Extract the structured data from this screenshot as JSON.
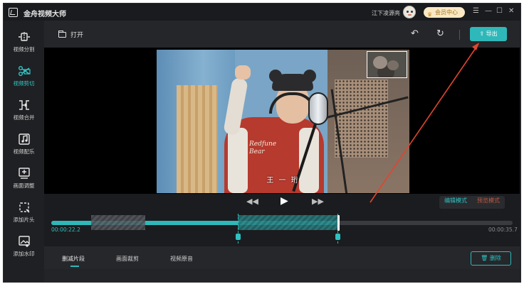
{
  "app": {
    "title": "金舟视频大师",
    "username": "江下凌源亮",
    "vip_label": "会员中心",
    "window_controls": [
      "☰",
      "—",
      "☐",
      "✕"
    ]
  },
  "sidebar": {
    "items": [
      {
        "label": "视频分割",
        "icon": "split-icon",
        "active": false
      },
      {
        "label": "视频剪切",
        "icon": "scissors-icon",
        "active": true
      },
      {
        "label": "视频合并",
        "icon": "merge-icon",
        "active": false
      },
      {
        "label": "视频配乐",
        "icon": "music-icon",
        "active": false
      },
      {
        "label": "画面调整",
        "icon": "adjust-icon",
        "active": false
      },
      {
        "label": "添加片头",
        "icon": "intro-icon",
        "active": false
      },
      {
        "label": "添加水印",
        "icon": "watermark-icon",
        "active": false
      }
    ]
  },
  "toolbar": {
    "open_label": "打开",
    "undo_icon": "undo-icon",
    "redo_icon": "redo-icon",
    "export_label": "导出"
  },
  "preview": {
    "subtitle": "王 一 珩",
    "jacket_text": "Redfune\nBear"
  },
  "playback": {
    "prev_icon": "◀◀",
    "play_icon": "▶",
    "next_icon": "▶▶",
    "mode_edit": "编辑模式",
    "mode_preview": "预览模式"
  },
  "timeline": {
    "current_time": "00:00:22.2",
    "total_time": "00:00:35.7",
    "progress_fraction": 0.622
  },
  "bottom": {
    "tabs": [
      "删减片段",
      "画面裁剪",
      "视频原音"
    ],
    "delete_label": "删除"
  },
  "colors": {
    "accent": "#2fb8b9",
    "annotation_arrow": "#e0452f",
    "background": "#1f2023"
  }
}
